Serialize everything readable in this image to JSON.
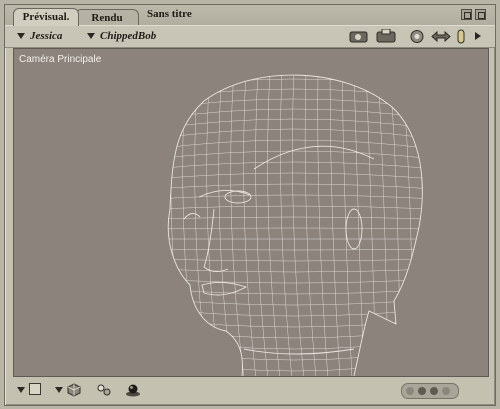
{
  "tabs": [
    {
      "label": "Prévisual.",
      "active": true
    },
    {
      "label": "Rendu",
      "active": false
    }
  ],
  "document_title": "Sans titre",
  "toolbar": {
    "figure_menu": "Jessica",
    "part_menu": "ChippedBob",
    "icons": [
      "camera-face-icon",
      "camera-hand-icon",
      "rotate-icon",
      "move-icon",
      "light-icon",
      "more-arrow-icon"
    ]
  },
  "viewport": {
    "camera_label": "Caméra Principale",
    "render_style": "wireframe"
  },
  "bottom_bar": {
    "icons": [
      "display-style-icon",
      "figure-style-icon",
      "element-icon",
      "ground-shadow-icon",
      "nav-dots"
    ]
  },
  "colors": {
    "viewport_bg": "#8c837c",
    "wire": "#e9e5df"
  }
}
